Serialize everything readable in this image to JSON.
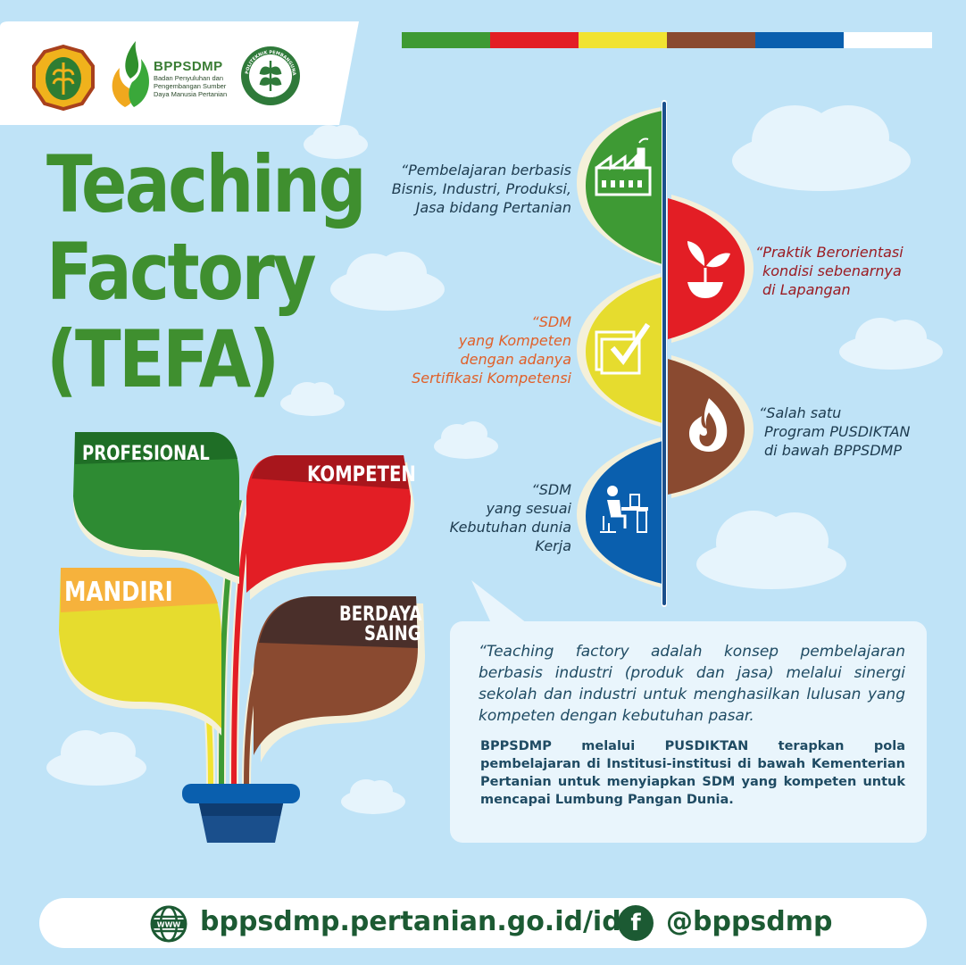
{
  "header": {
    "org_abbrev": "BPPSDMP",
    "org_fullname_lines": [
      "Badan Penyuluhan dan",
      "Pengembangan Sumber",
      "Daya Manusia Pertanian"
    ],
    "logo_ring_text": "POLITEKNIK PEMBANGUNAN PERTANIAN",
    "logo_ring_bottom": "MALANG"
  },
  "color_strip": [
    "#3e9a34",
    "#e31e25",
    "#f1e331",
    "#8a4a30",
    "#0a5fae",
    "#ffffff"
  ],
  "title_lines": [
    "Teaching",
    "Factory",
    "(TEFA)"
  ],
  "plant": {
    "leaves": [
      "PROFESIONAL",
      "KOMPETEN",
      "MANDIRI"
    ],
    "berdaya_lines": [
      "BERDAYA",
      "SAING"
    ]
  },
  "features": [
    {
      "lines": [
        "“Pembelajaran berbasis",
        "Bisnis, Industri, Produksi,",
        "Jasa bidang Pertanian"
      ],
      "color": "#1d3b4f",
      "icon": "factory-icon"
    },
    {
      "lines": [
        "“Praktik Berorientasi",
        "kondisi sebenarnya",
        "di Lapangan"
      ],
      "color": "#9b1b22",
      "icon": "sprout-icon"
    },
    {
      "lines": [
        "“SDM",
        "yang Kompeten",
        "dengan adanya",
        "Sertifikasi Kompetensi"
      ],
      "color": "#e0602a",
      "icon": "certificate-icon"
    },
    {
      "lines": [
        "“Salah satu",
        "Program PUSDIKTAN",
        "di bawah BPPSDMP"
      ],
      "color": "#1d3b4f",
      "icon": "flame-icon"
    },
    {
      "lines": [
        "“SDM",
        "yang sesuai",
        "Kebutuhan dunia",
        "Kerja"
      ],
      "color": "#1d3b4f",
      "icon": "worker-desk-icon"
    }
  ],
  "description": {
    "italic": "“Teaching factory adalah konsep pembelajaran berbasis industri (produk dan jasa) melalui sinergi sekolah dan industri untuk menghasilkan lulusan yang kompeten dengan kebutuhan pasar.",
    "bold": "BPPSDMP melalui PUSDIKTAN terapkan pola pembelajaran di Institusi-institusi di bawah Kementerian Pertanian untuk menyiapkan SDM yang kompeten untuk mencapai Lumbung Pangan Dunia."
  },
  "footer": {
    "website": "bppsdmp.pertanian.go.id/id",
    "www_icon_label": "WWW",
    "facebook_glyph": "f",
    "social_handle": "@bppsdmp"
  }
}
